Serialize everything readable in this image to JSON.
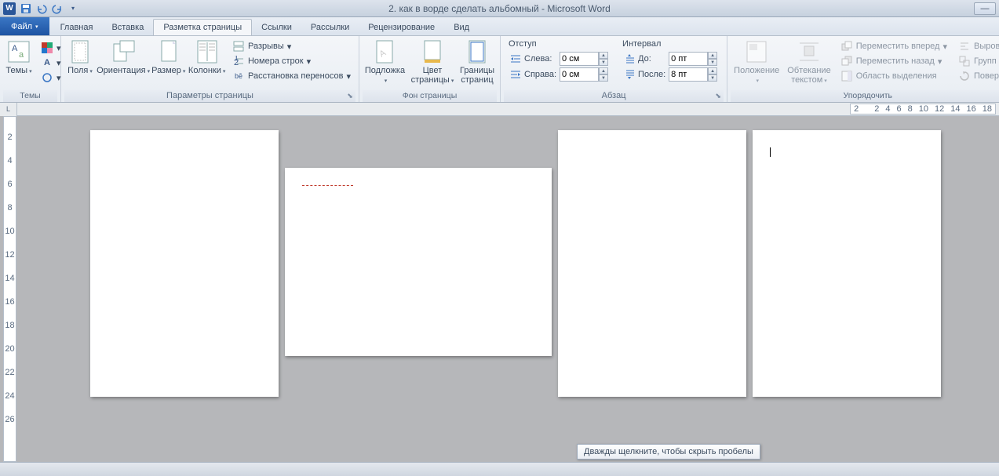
{
  "titlebar": {
    "app_icon": "W",
    "title": "2. как в ворде сделать альбомный - Microsoft Word"
  },
  "tabs": {
    "file": "Файл",
    "items": [
      "Главная",
      "Вставка",
      "Разметка страницы",
      "Ссылки",
      "Рассылки",
      "Рецензирование",
      "Вид"
    ],
    "active_index": 2
  },
  "ribbon": {
    "themes": {
      "label": "Темы",
      "title": "Темы"
    },
    "page_setup": {
      "title": "Параметры страницы",
      "margins": "Поля",
      "orientation": "Ориентация",
      "size": "Размер",
      "columns": "Колонки",
      "breaks": "Разрывы",
      "line_numbers": "Номера строк",
      "hyphenation": "Расстановка переносов"
    },
    "page_bg": {
      "title": "Фон страницы",
      "watermark": "Подложка",
      "page_color": "Цвет",
      "page_color2": "страницы",
      "borders": "Границы",
      "borders2": "страниц"
    },
    "paragraph": {
      "title": "Абзац",
      "indent_header": "Отступ",
      "indent_left_label": "Слева:",
      "indent_left_value": "0 см",
      "indent_right_label": "Справа:",
      "indent_right_value": "0 см",
      "spacing_header": "Интервал",
      "spacing_before_label": "До:",
      "spacing_before_value": "0 пт",
      "spacing_after_label": "После:",
      "spacing_after_value": "8 пт"
    },
    "arrange": {
      "title": "Упорядочить",
      "position": "Положение",
      "wrap": "Обтекание",
      "wrap2": "текстом",
      "bring_forward": "Переместить вперед",
      "send_backward": "Переместить назад",
      "selection_pane": "Область выделения",
      "align": "Выров",
      "group": "Групп",
      "rotate": "Повер"
    }
  },
  "ruler": {
    "h_ticks": [
      "2",
      "",
      "2",
      "4",
      "6",
      "8",
      "10",
      "12",
      "14",
      "16",
      "18"
    ],
    "v_ticks": [
      "2",
      "4",
      "6",
      "8",
      "10",
      "12",
      "14",
      "16",
      "18",
      "20",
      "22",
      "24",
      "26"
    ]
  },
  "tooltip": "Дважды щелкните, чтобы скрыть пробелы"
}
